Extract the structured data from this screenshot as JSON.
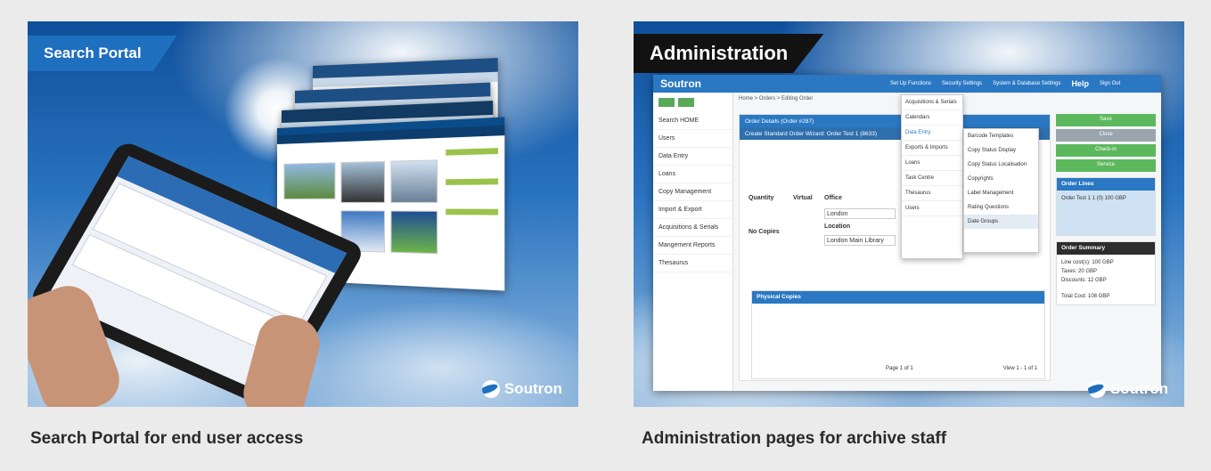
{
  "panels": [
    {
      "banner": "Search Portal",
      "logo": "Soutron",
      "caption": "Search Portal for end user access"
    },
    {
      "banner": "Administration",
      "logo": "Soutron",
      "caption": "Administration pages for archive staff"
    }
  ],
  "admin": {
    "brand": "Soutron",
    "menu": [
      "Set Up Functions",
      "Security Settings",
      "System & Database Settings",
      "Help",
      "Sign Out"
    ],
    "breadcrumb": "Home > Orders > Editing Order",
    "sidebar": [
      "Search HOME",
      "Users",
      "Data Entry",
      "Loans",
      "Copy Management",
      "Import & Export",
      "Acquisitions & Serials",
      "Mangement Reports",
      "Thesaurus"
    ],
    "order_details": "Order Details (Order #287)",
    "wizard": "Create Standard Order Wizard: Order Test 1 (8633)",
    "dropdown1": [
      "Acquisitions & Serials",
      "Calendars",
      "Data Entry",
      "Exports & Imports",
      "Loans",
      "Task Centre",
      "Thesaurus",
      "Users"
    ],
    "dropdown2": [
      "Barcode Templates",
      "Copy Status Display",
      "Copy Status Localisation",
      "Copyrights",
      "Label Management",
      "Rating Questions",
      "Date Groups"
    ],
    "right_buttons": [
      "Save",
      "Close",
      "Check-in",
      "Service"
    ],
    "order_lines_title": "Order Lines",
    "order_lines_row": "Order Test 1   1 (0)   100 GBP",
    "order_summary_title": "Order Summary",
    "order_summary": [
      "Line cost(s): 100 GBP",
      "Taxes: 20 GBP",
      "Discounts: 12 GBP",
      "Total Cost: 108 GBP"
    ],
    "physical_copies": "Physical Copies",
    "fields": {
      "quantity": "Quantity",
      "virtual": "Virtual",
      "office": "Office",
      "location": "Location",
      "no_copies": "No Copies",
      "office_val": "London",
      "location_val": "London Main Library"
    },
    "pager": "Page 1 of 1",
    "view": "View 1 - 1 of 1"
  },
  "colors": {
    "brand_blue": "#1f6fbf",
    "admin_blue": "#2a78c3",
    "green": "#5cb85c"
  }
}
